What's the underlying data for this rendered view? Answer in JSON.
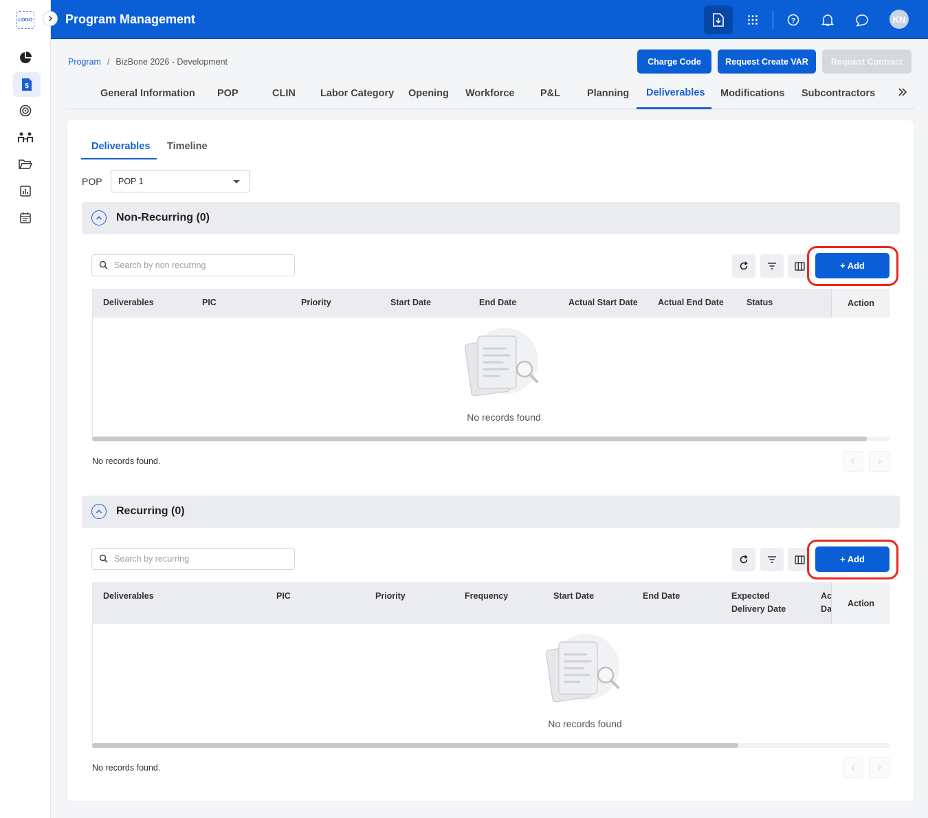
{
  "app": {
    "logo_text": "LOGO",
    "title": "Program Management",
    "avatar_initials": "KN"
  },
  "breadcrumb": {
    "root": "Program",
    "separator": "/",
    "current": "BizBone 2026 - Development"
  },
  "actions": {
    "charge_code": "Charge Code",
    "request_var": "Request Create VAR",
    "request_contract": "Request Contract"
  },
  "tabs": [
    {
      "label": "General Information"
    },
    {
      "label": "POP"
    },
    {
      "label": "CLIN"
    },
    {
      "label": "Labor Category"
    },
    {
      "label": "Opening"
    },
    {
      "label": "Workforce"
    },
    {
      "label": "P&L"
    },
    {
      "label": "Planning"
    },
    {
      "label": "Deliverables"
    },
    {
      "label": "Modifications"
    },
    {
      "label": "Subcontractors"
    }
  ],
  "subtabs": [
    {
      "label": "Deliverables"
    },
    {
      "label": "Timeline"
    }
  ],
  "pop": {
    "label": "POP",
    "selected": "POP 1"
  },
  "non_recurring": {
    "title": "Non-Recurring (0)",
    "search_placeholder": "Search by non recurring",
    "add_label": "+ Add",
    "columns": [
      "Deliverables",
      "PIC",
      "Priority",
      "Start Date",
      "End Date",
      "Actual Start Date",
      "Actual End Date",
      "Status"
    ],
    "action_label": "Action",
    "empty_text": "No records found",
    "footer_text": "No records found."
  },
  "recurring": {
    "title": "Recurring (0)",
    "search_placeholder": "Search by recurring",
    "add_label": "+ Add",
    "columns": [
      "Deliverables",
      "PIC",
      "Priority",
      "Frequency",
      "Start Date",
      "End Date",
      "Expected Delivery Date",
      "Ac Da"
    ],
    "action_label": "Action",
    "empty_text": "No records found",
    "footer_text": "No records found."
  },
  "colors": {
    "primary": "#0a5fd7",
    "highlight": "#e8281e"
  }
}
